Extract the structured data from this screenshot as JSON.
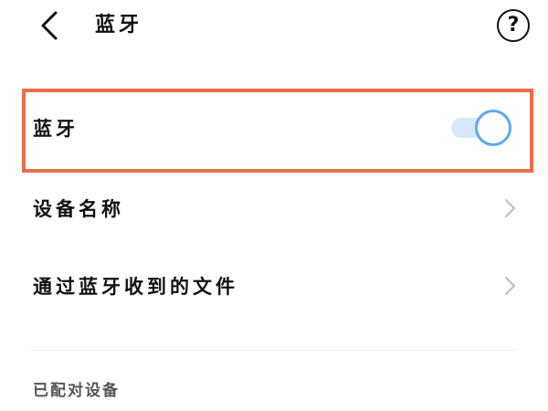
{
  "header": {
    "title": "蓝牙",
    "back_icon": "chevron-left-icon",
    "help_icon": "question-circle-icon",
    "help_glyph": "?"
  },
  "settings": {
    "bluetooth": {
      "label": "蓝牙",
      "enabled": true
    },
    "device_name": {
      "label": "设备名称",
      "icon": "chevron-right-icon"
    },
    "received_files": {
      "label": "通过蓝牙收到的文件",
      "icon": "chevron-right-icon"
    }
  },
  "paired_section": {
    "title": "已配对设备"
  },
  "colors": {
    "highlight_border": "#ec6d4b",
    "toggle_track": "#d6e9fb",
    "toggle_knob_border": "#5aa9ee",
    "chevron": "#bdbdbd"
  }
}
